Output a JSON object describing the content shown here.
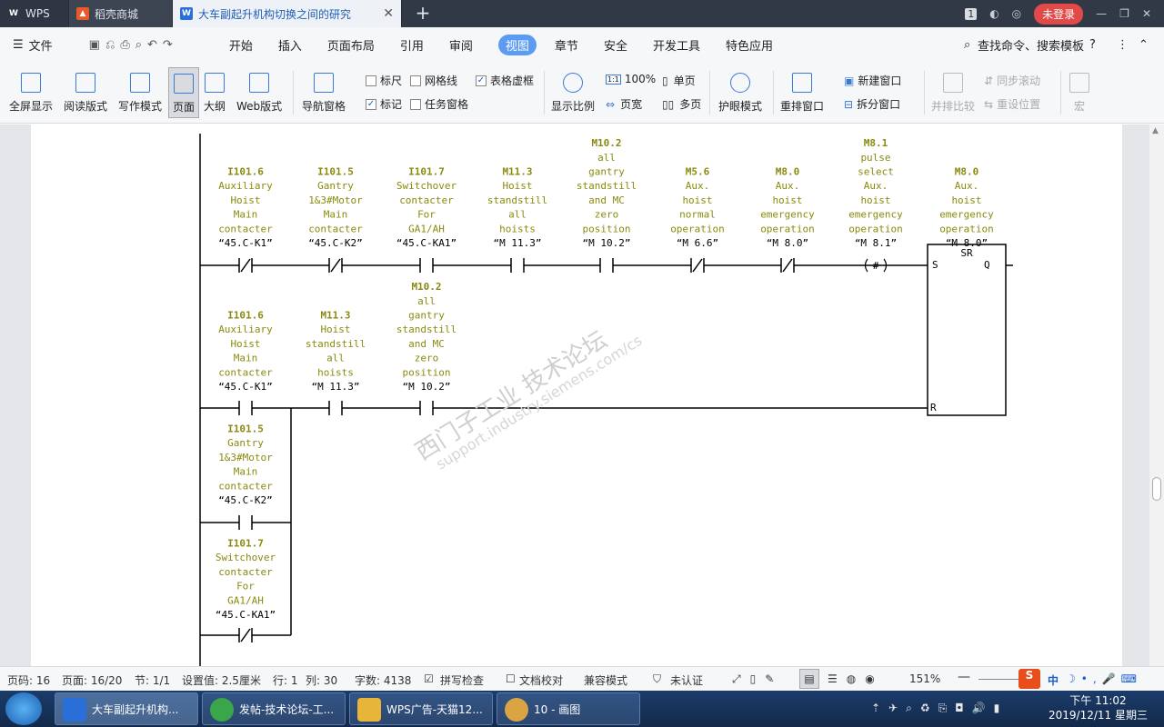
{
  "titlebar": {
    "wps": "WPS",
    "shop": "稻壳商城",
    "doc_title": "大车副起升机构切换之间的研究",
    "page_badge": "1",
    "login": "未登录"
  },
  "menu": [
    "文件",
    "开始",
    "插入",
    "页面布局",
    "引用",
    "审阅",
    "视图",
    "章节",
    "安全",
    "开发工具",
    "特色应用"
  ],
  "menu_active": "视图",
  "search": "查找命令、搜索模板",
  "ribbon": {
    "fullscreen": "全屏显示",
    "read": "阅读版式",
    "write": "写作模式",
    "page": "页面",
    "outline": "大纲",
    "web": "Web版式",
    "nav": "导航窗格",
    "ruler": "标尺",
    "grid": "网格线",
    "tablegrid": "表格虚框",
    "mark": "标记",
    "taskpane": "任务窗格",
    "zoom": "显示比例",
    "zoom100": "100%",
    "pagewidth": "页宽",
    "single": "单页",
    "multi": "多页",
    "eye": "护眼模式",
    "rearrange": "重排窗口",
    "newwin": "新建窗口",
    "split": "拆分窗口",
    "sidebyside": "并排比较",
    "sync": "同步滚动",
    "resetpos": "重设位置",
    "macro": "宏"
  },
  "ladder": {
    "row1": [
      {
        "addr": "I101.6",
        "desc": [
          "Auxiliary",
          "Hoist",
          "Main",
          "contacter"
        ],
        "sym": "“45.C-K1”"
      },
      {
        "addr": "I101.5",
        "desc": [
          "Gantry",
          "1&3#Motor",
          "Main",
          "contacter"
        ],
        "sym": "“45.C-K2”"
      },
      {
        "addr": "I101.7",
        "desc": [
          "Switchover",
          "contacter",
          "For",
          "GA1/AH"
        ],
        "sym": "“45.C-KA1”"
      },
      {
        "addr": "M11.3",
        "desc": [
          "Hoist",
          "standstill",
          "all",
          "hoists"
        ],
        "sym": "“M  11.3”"
      },
      {
        "addr": "M10.2",
        "desc": [
          "all",
          "gantry",
          "standstill",
          "and MC",
          "zero",
          "position"
        ],
        "sym": "“M  10.2”"
      },
      {
        "addr": "M5.6",
        "desc": [
          "Aux.",
          "hoist",
          "normal",
          "operation"
        ],
        "sym": "“M  6.6”"
      },
      {
        "addr": "M8.0",
        "desc": [
          "Aux.",
          "hoist",
          "emergency",
          "operation"
        ],
        "sym": "“M  8.0”"
      },
      {
        "addr": "M8.1",
        "desc": [
          "pulse",
          "select",
          "Aux.",
          "hoist",
          "emergency",
          "operation"
        ],
        "sym": "“M  8.1”"
      },
      {
        "addr": "M8.0",
        "desc": [
          "Aux.",
          "hoist",
          "emergency",
          "operation"
        ],
        "sym": "“M  8.0”"
      }
    ],
    "row2": [
      {
        "addr": "I101.6",
        "desc": [
          "Auxiliary",
          "Hoist",
          "Main",
          "contacter"
        ],
        "sym": "“45.C-K1”"
      },
      {
        "addr": "M11.3",
        "desc": [
          "Hoist",
          "standstill",
          "all",
          "hoists"
        ],
        "sym": "“M  11.3”"
      },
      {
        "addr": "M10.2",
        "desc": [
          "all",
          "gantry",
          "standstill",
          "and MC",
          "zero",
          "position"
        ],
        "sym": "“M  10.2”"
      }
    ],
    "branch": [
      {
        "addr": "I101.5",
        "desc": [
          "Gantry",
          "1&3#Motor",
          "Main",
          "contacter"
        ],
        "sym": "“45.C-K2”"
      },
      {
        "addr": "I101.7",
        "desc": [
          "Switchover",
          "contacter",
          "For",
          "GA1/AH"
        ],
        "sym": "“45.C-KA1”"
      }
    ],
    "sr": {
      "title": "SR",
      "s": "S",
      "q": "Q",
      "r": "R"
    },
    "coil": "#",
    "watermark1": "西门子工业 技术论坛",
    "watermark2": "support.industry.siemens.com/cs"
  },
  "status": {
    "page": "页码: 16",
    "pages": "页面: 16/20",
    "section": "节: 1/1",
    "setting": "设置值: 2.5厘米",
    "row": "行: 1",
    "col": "列: 30",
    "words": "字数: 4138",
    "spell": "拼写检查",
    "proof": "文档校对",
    "compat": "兼容模式",
    "cert": "未认证",
    "zoom": "151%"
  },
  "taskbar": {
    "t1": "大车副起升机构...",
    "t2": "发帖-技术论坛-工...",
    "t3": "WPS广告-天猫12...",
    "t4": "10 - 画图",
    "time": "下午 11:02",
    "date": "2019/12/11 星期三",
    "ime": "中"
  }
}
